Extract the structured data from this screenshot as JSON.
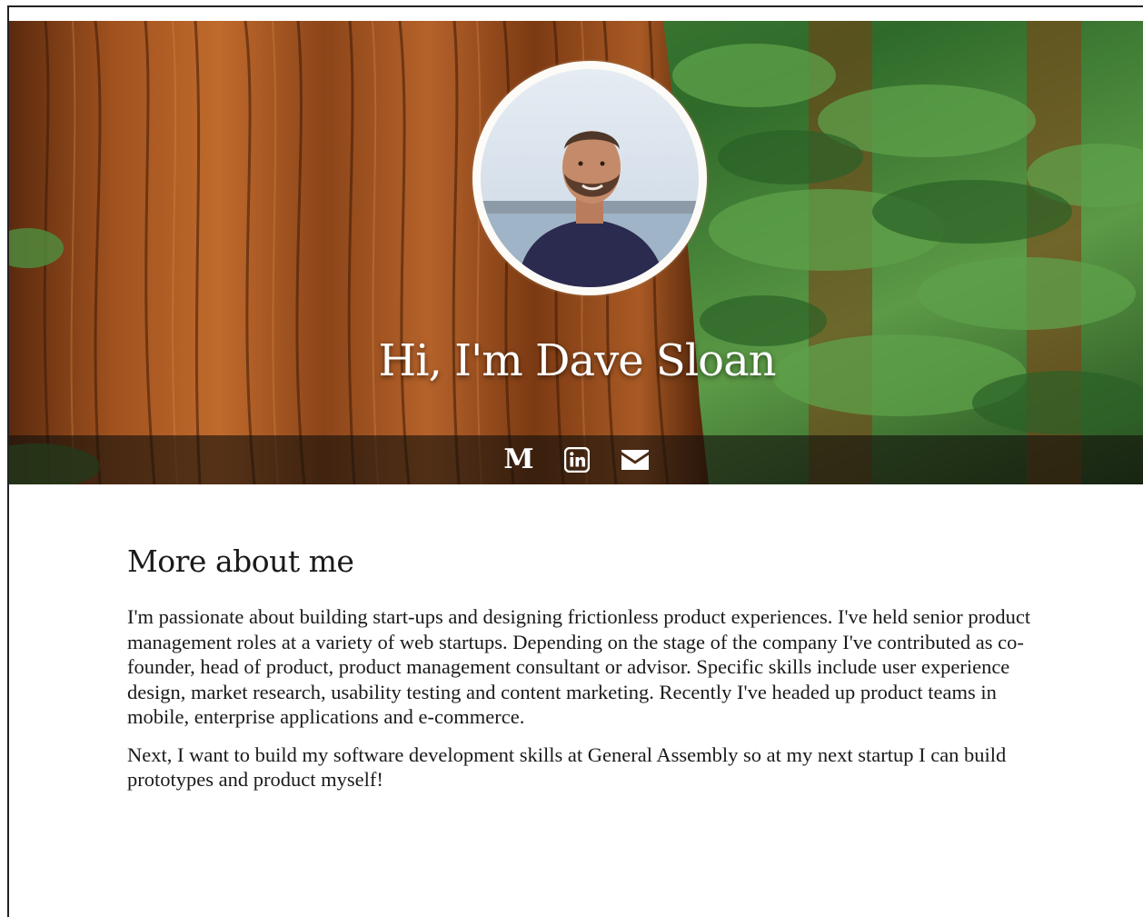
{
  "hero": {
    "title": "Hi, I'm Dave Sloan",
    "background_colors": {
      "bark": "#9a4f1f",
      "foliage": "#3f7a32"
    }
  },
  "social": [
    {
      "name": "medium",
      "icon": "medium-icon",
      "glyph": "M"
    },
    {
      "name": "linkedin",
      "icon": "linkedin-icon"
    },
    {
      "name": "email",
      "icon": "envelope-icon"
    }
  ],
  "about": {
    "heading": "More about me",
    "paragraphs": [
      "I'm passionate about building start-ups and designing frictionless product experiences. I've held senior product management roles at a variety of web startups. Depending on the stage of the company I've contributed as co-founder, head of product, product management consultant or advisor. Specific skills include user experience design, market research, usability testing and content marketing. Recently I've headed up product teams in mobile, enterprise applications and e-commerce.",
      "Next, I want to build my software development skills at General Assembly so at my next startup I can build prototypes and product myself!"
    ]
  }
}
